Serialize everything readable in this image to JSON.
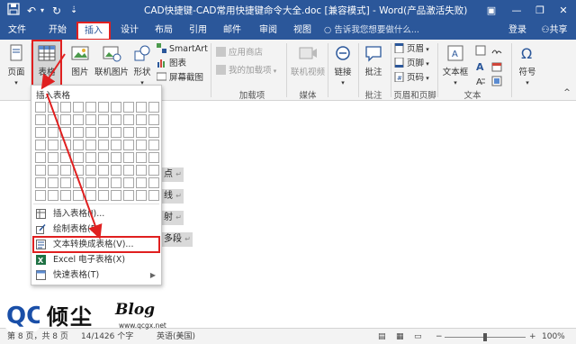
{
  "titlebar": {
    "title": "CAD快捷键-CAD常用快捷键命令大全.doc [兼容模式] - Word(产品激活失败)",
    "save_icon": "save-icon",
    "undo_glyph": "↶",
    "dropdown_glyph": "▾",
    "redo_glyph": "↻",
    "customize_glyph": "⇣",
    "ribbon_options_glyph": "▣",
    "minimize_glyph": "—",
    "restore_glyph": "❐",
    "close_glyph": "✕"
  },
  "tabs": {
    "items": [
      "文件",
      "开始",
      "插入",
      "设计",
      "布局",
      "引用",
      "邮件",
      "审阅",
      "视图"
    ],
    "active_index": 2,
    "tell_me": "告诉我您想要做什么...",
    "signin": "登录",
    "share": "共享"
  },
  "ribbon": {
    "pages": "页面",
    "table": "表格",
    "pictures": "图片",
    "online_pictures": "联机图片",
    "shapes": "形状",
    "smartart": "SmartArt",
    "chart": "图表",
    "screenshot": "屏幕截图",
    "store": "应用商店",
    "my_addins": "我的加载项",
    "online_video": "联机视频",
    "link": "链接",
    "comment": "批注",
    "header": "页眉",
    "footer": "页脚",
    "page_number": "页码",
    "textbox": "文本框",
    "symbol": "符号",
    "groups": {
      "addins": "加载项",
      "media": "媒体",
      "comments": "批注",
      "header_footer": "页眉和页脚",
      "text": "文本"
    }
  },
  "document": {
    "lines": [
      "点",
      "线",
      "射",
      "多段"
    ],
    "para_mark": "↵"
  },
  "dropdown": {
    "header": "插入表格",
    "grid_cols": 10,
    "grid_rows": 8,
    "items": [
      {
        "label": "插入表格(I)...",
        "icon": "insert-table-icon"
      },
      {
        "label": "绘制表格(D)",
        "icon": "draw-table-icon"
      },
      {
        "label": "文本转换成表格(V)...",
        "icon": "convert-text-table-icon",
        "highlighted": true
      },
      {
        "label": "Excel 电子表格(X)",
        "icon": "excel-icon"
      },
      {
        "label": "快速表格(T)",
        "icon": "quick-tables-icon",
        "submenu": true
      }
    ]
  },
  "statusbar": {
    "page": "第 8 页，共 8 页",
    "words": "14/1426 个字",
    "language": "英语(美国)",
    "zoom_minus": "−",
    "zoom_plus": "+",
    "zoom": "100%"
  },
  "watermark": {
    "logo_text": "QC",
    "name": "倾尘",
    "blog": "Blog",
    "url": "www.qcgx.net"
  },
  "colors": {
    "word_blue": "#2b579a",
    "highlight_red": "#e02020"
  }
}
